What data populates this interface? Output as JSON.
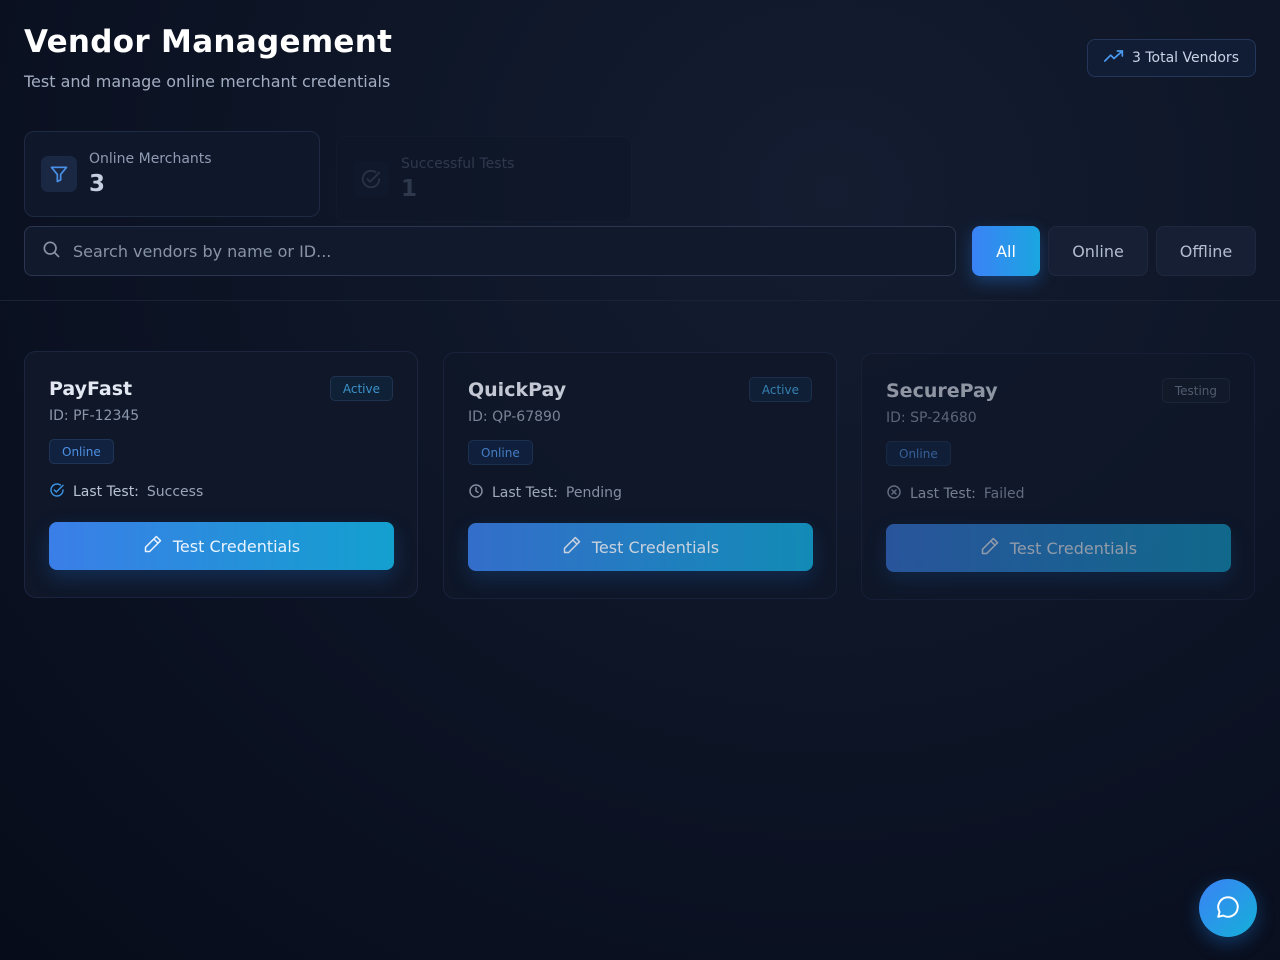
{
  "header": {
    "title": "Vendor Management",
    "subtitle": "Test and manage online merchant credentials"
  },
  "total_badge": {
    "label": "3 Total Vendors",
    "icon": "trending-up-icon"
  },
  "stats": [
    {
      "label": "Online Merchants",
      "value": "3",
      "icon": "filter-icon"
    },
    {
      "label": "Successful Tests",
      "value": "1",
      "icon": "check-circle-icon"
    }
  ],
  "search": {
    "placeholder": "Search vendors by name or ID...",
    "value": ""
  },
  "filters": {
    "all": "All",
    "online": "Online",
    "offline": "Offline",
    "selected": "All"
  },
  "vendors": [
    {
      "name": "PayFast",
      "id": "ID: PF-12345",
      "status": "Active",
      "connection": "Online",
      "last_test_label": "Last Test:",
      "last_test_value": "Success",
      "button": "Test Credentials"
    },
    {
      "name": "QuickPay",
      "id": "ID: QP-67890",
      "status": "Active",
      "connection": "Online",
      "last_test_label": "Last Test:",
      "last_test_value": "Pending",
      "button": "Test Credentials"
    },
    {
      "name": "SecurePay",
      "id": "ID: SP-24680",
      "status": "Testing",
      "connection": "Online",
      "last_test_label": "Last Test:",
      "last_test_value": "Failed",
      "button": "Test Credentials"
    }
  ],
  "colors": {
    "accent": "#3b82f6",
    "accent_alt": "#14b0d8",
    "background": "#0d1526"
  },
  "chat": {
    "icon": "chat-bubble-icon"
  }
}
